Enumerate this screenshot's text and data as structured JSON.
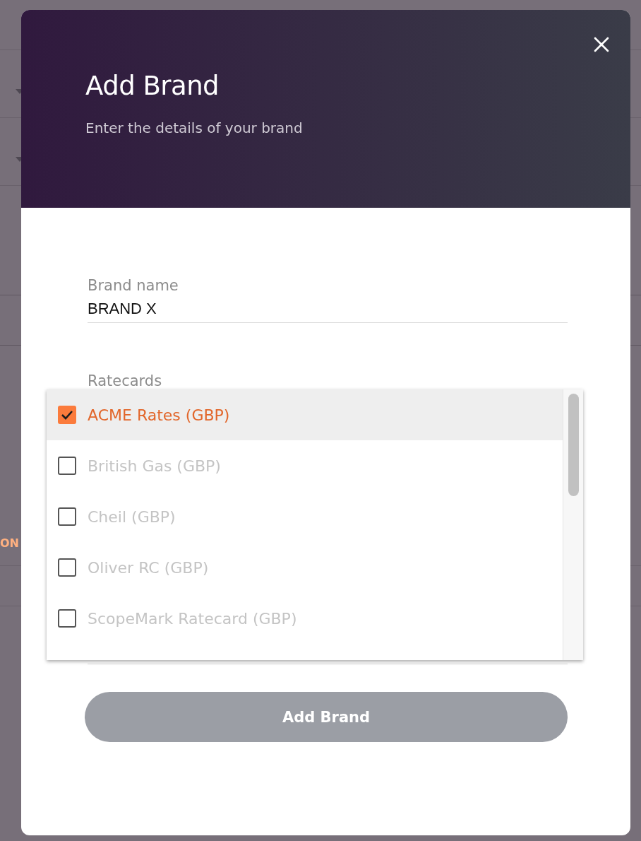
{
  "background_page": {
    "label": "ON"
  },
  "dialog": {
    "title": "Add Brand",
    "subtitle": "Enter the details of your brand"
  },
  "brand_name": {
    "label": "Brand name",
    "value": "BRAND X"
  },
  "ratecards": {
    "label": "Ratecards",
    "options": [
      {
        "label": "ACME Rates (GBP)",
        "checked": true,
        "selected": true
      },
      {
        "label": "British Gas (GBP)",
        "checked": false,
        "selected": false
      },
      {
        "label": "Cheil (GBP)",
        "checked": false,
        "selected": false
      },
      {
        "label": "Oliver RC (GBP)",
        "checked": false,
        "selected": false
      },
      {
        "label": "ScopeMark Ratecard (GBP)",
        "checked": false,
        "selected": false
      }
    ]
  },
  "submit": {
    "label": "Add Brand",
    "disabled": true
  }
}
